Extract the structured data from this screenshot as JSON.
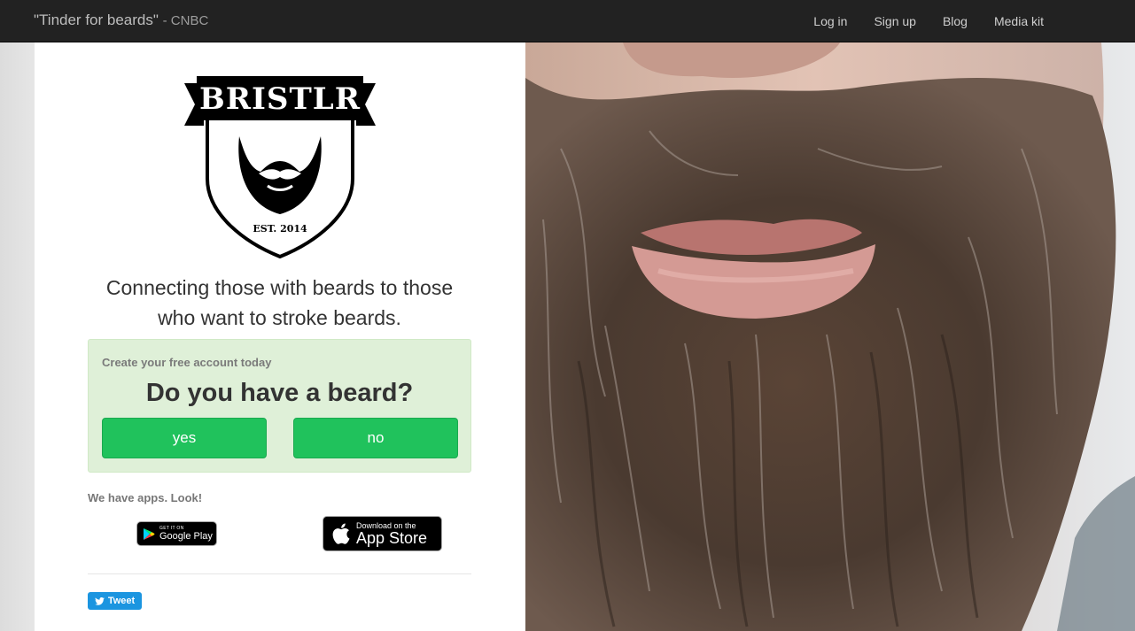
{
  "navbar": {
    "brand_quote": "\"Tinder for beards\"",
    "brand_source": "- CNBC",
    "links": [
      "Log in",
      "Sign up",
      "Blog",
      "Media kit"
    ]
  },
  "logo": {
    "wordmark": "BRISTLR",
    "established": "EST. 2014"
  },
  "tagline": "Connecting those with beards to those who want to stroke beards.",
  "signup": {
    "subtitle": "Create your free account today",
    "question": "Do you have a beard?",
    "yes_label": "yes",
    "no_label": "no"
  },
  "apps": {
    "label": "We have apps. Look!",
    "google_play_small": "GET IT ON",
    "google_play_big": "Google Play",
    "app_store_small": "Download on the",
    "app_store_big": "App Store"
  },
  "tweet_label": "Tweet",
  "colors": {
    "navbar_bg": "#222222",
    "button_green": "#20c25c",
    "signup_bg": "#dff0d8",
    "tweet_blue": "#1b95e0"
  },
  "icons": [
    "google-play-icon",
    "apple-icon",
    "twitter-bird-icon"
  ]
}
